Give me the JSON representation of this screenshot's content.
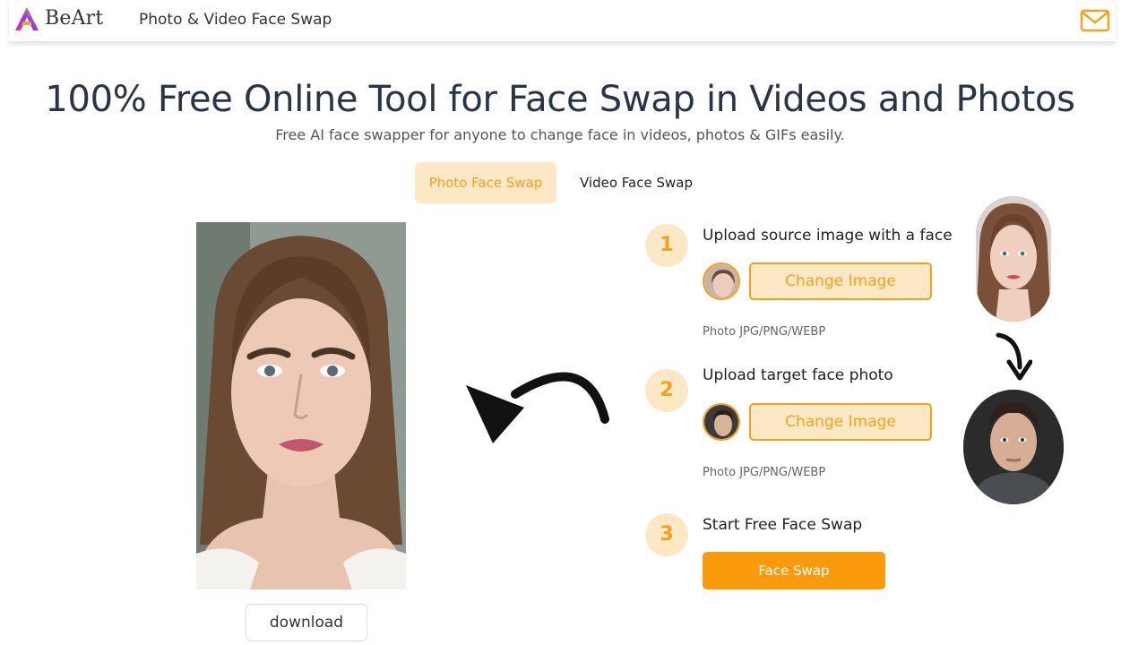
{
  "header": {
    "brand": "BeArt",
    "nav_link": "Photo & Video Face Swap",
    "mail_icon": "mail-icon"
  },
  "hero": {
    "title": "100% Free Online Tool for Face Swap in Videos and Photos",
    "subtitle": "Free AI face swapper for anyone to change face in videos, photos & GIFs easily."
  },
  "tabs": [
    {
      "label": "Photo Face Swap",
      "active": true
    },
    {
      "label": "Video Face Swap",
      "active": false
    }
  ],
  "preview": {
    "download_label": "download"
  },
  "steps": [
    {
      "number": "1",
      "title": "Upload source image with a face",
      "button": "Change Image",
      "hint": "Photo JPG/PNG/WEBP"
    },
    {
      "number": "2",
      "title": "Upload target face photo",
      "button": "Change Image",
      "hint": "Photo JPG/PNG/WEBP"
    },
    {
      "number": "3",
      "title": "Start Free Face Swap",
      "button": "Face Swap"
    }
  ],
  "colors": {
    "accent": "#f4a21b",
    "accent_light": "#fde8c6",
    "primary_button": "#fb9a0b",
    "title_text": "#2b3346"
  }
}
